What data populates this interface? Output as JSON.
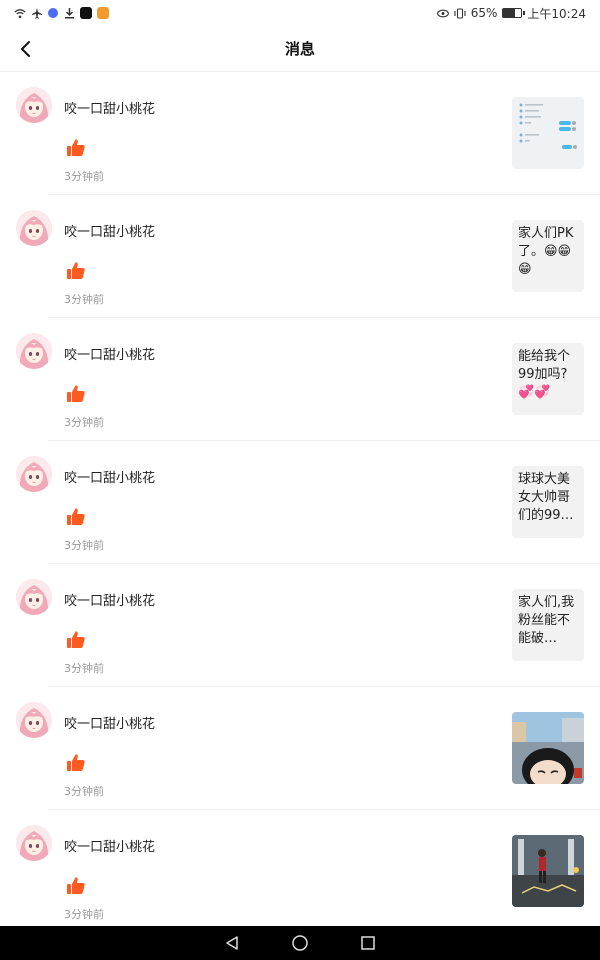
{
  "status_bar": {
    "battery": "65%",
    "time": "上午10:24",
    "battery_level": 0.65
  },
  "header": {
    "title": "消息"
  },
  "messages": [
    {
      "user": "咬一口甜小桃花",
      "time": "3分钟前",
      "thumb_type": "image",
      "thumb_image": "chat-screenshot"
    },
    {
      "user": "咬一口甜小桃花",
      "time": "3分钟前",
      "thumb_type": "text",
      "thumb_text": "家人们PK了。😁😁😁"
    },
    {
      "user": "咬一口甜小桃花",
      "time": "3分钟前",
      "thumb_type": "text",
      "thumb_text": "能给我个99加吗?💞💞"
    },
    {
      "user": "咬一口甜小桃花",
      "time": "3分钟前",
      "thumb_type": "text",
      "thumb_text": "球球大美女大帅哥们的99…"
    },
    {
      "user": "咬一口甜小桃花",
      "time": "3分钟前",
      "thumb_type": "text",
      "thumb_text": "家人们,我粉丝能不能破…"
    },
    {
      "user": "咬一口甜小桃花",
      "time": "3分钟前",
      "thumb_type": "image",
      "thumb_image": "game-screenshot-girl-face"
    },
    {
      "user": "咬一口甜小桃花",
      "time": "3分钟前",
      "thumb_type": "image",
      "thumb_image": "game-screenshot-character"
    }
  ],
  "icons": {
    "back": "chevron-left-icon",
    "like": "thumbs-up-icon",
    "sys_back": "triangle-back-icon",
    "sys_home": "circle-home-icon",
    "sys_recent": "square-recent-icon"
  },
  "colors": {
    "like": "#ff5a1f",
    "avatar_hair": "#f0a9b8",
    "time_text": "#999999",
    "nav_bar_bg": "#000000"
  }
}
